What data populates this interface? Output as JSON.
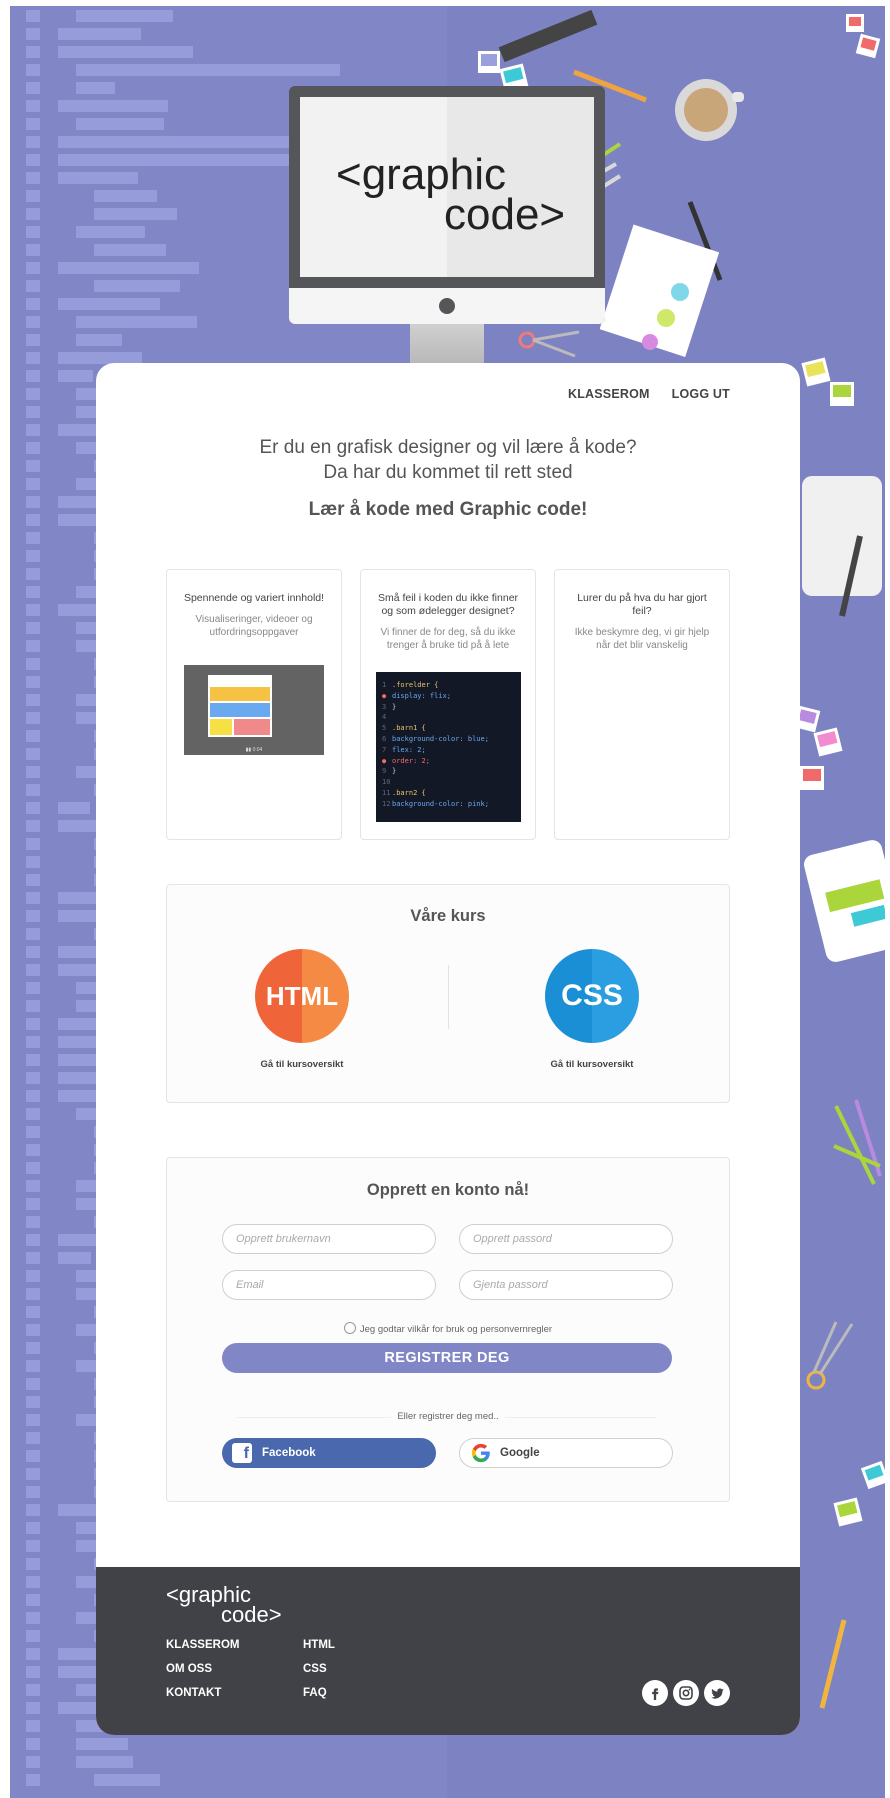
{
  "brand": {
    "logo_line1": "<graphic",
    "logo_line2": "code>"
  },
  "nav": {
    "items": [
      "KLASSEROM",
      "LOGG UT"
    ]
  },
  "hero": {
    "line1": "Er du en grafisk designer og vil lære å kode?",
    "line2": "Da har du kommet til rett sted",
    "headline": "Lær å kode med Graphic code!"
  },
  "features": [
    {
      "title": "Spennende og variert innhold!",
      "description": "Visualiseringer, videoer og utfordringsoppgaver",
      "video_time": "0:04"
    },
    {
      "title": "Små feil i koden du ikke finner og som ødelegger designet?",
      "description": "Vi finner de for deg, så du ikke trenger å bruke tid på å lete"
    },
    {
      "title": "Lurer du på hva du har gjort feil?",
      "description": "Ikke beskymre deg, vi gir hjelp når det blir vanskelig"
    }
  ],
  "code_sample": [
    {
      "n": "1",
      "text": ".forelder {",
      "color": "#e8c46a",
      "error": false
    },
    {
      "n": "2",
      "text": "display: flix;",
      "color": "#6aa8f0",
      "error": true
    },
    {
      "n": "3",
      "text": "}",
      "color": "#ccc",
      "error": false
    },
    {
      "n": "4",
      "text": "",
      "color": "#ccc",
      "error": false
    },
    {
      "n": "5",
      "text": ".barn1 {",
      "color": "#e8c46a",
      "error": false
    },
    {
      "n": "6",
      "text": "background-color: blue;",
      "color": "#6aa8f0",
      "error": false
    },
    {
      "n": "7",
      "text": "flex: 2;",
      "color": "#6aa8f0",
      "error": false
    },
    {
      "n": "8",
      "text": "order: 2;",
      "color": "#f06a6a",
      "error": true
    },
    {
      "n": "9",
      "text": "}",
      "color": "#ccc",
      "error": false
    },
    {
      "n": "10",
      "text": "",
      "color": "#ccc",
      "error": false
    },
    {
      "n": "11",
      "text": ".barn2 {",
      "color": "#e8c46a",
      "error": false
    },
    {
      "n": "12",
      "text": "background-color: pink;",
      "color": "#6aa8f0",
      "error": false
    }
  ],
  "courses": {
    "title": "Våre kurs",
    "items": [
      {
        "badge": "HTML",
        "link": "Gå til kursoversikt",
        "color": "#f0643a"
      },
      {
        "badge": "CSS",
        "link": "Gå til kursoversikt",
        "color": "#1a8fd6"
      }
    ]
  },
  "signup": {
    "title": "Opprett en konto nå!",
    "username_placeholder": "Opprett brukernavn",
    "password_placeholder": "Opprett passord",
    "email_placeholder": "Email",
    "repeat_password_placeholder": "Gjenta passord",
    "terms": "Jeg godtar vilkår for bruk og personvernregler",
    "register_label": "REGISTRER DEG",
    "or_text": "Eller registrer deg med..",
    "facebook_label": "Facebook",
    "google_label": "Google"
  },
  "footer": {
    "col1": [
      "KLASSEROM",
      "OM OSS",
      "KONTAKT"
    ],
    "col2": [
      "HTML",
      "CSS",
      "FAQ"
    ],
    "social": [
      "facebook-icon",
      "instagram-icon",
      "twitter-icon"
    ]
  },
  "colors": {
    "accent": "#8186c6",
    "footer": "#414248",
    "facebook": "#4a68ad",
    "html": "#f0643a",
    "css": "#1a8fd6"
  }
}
